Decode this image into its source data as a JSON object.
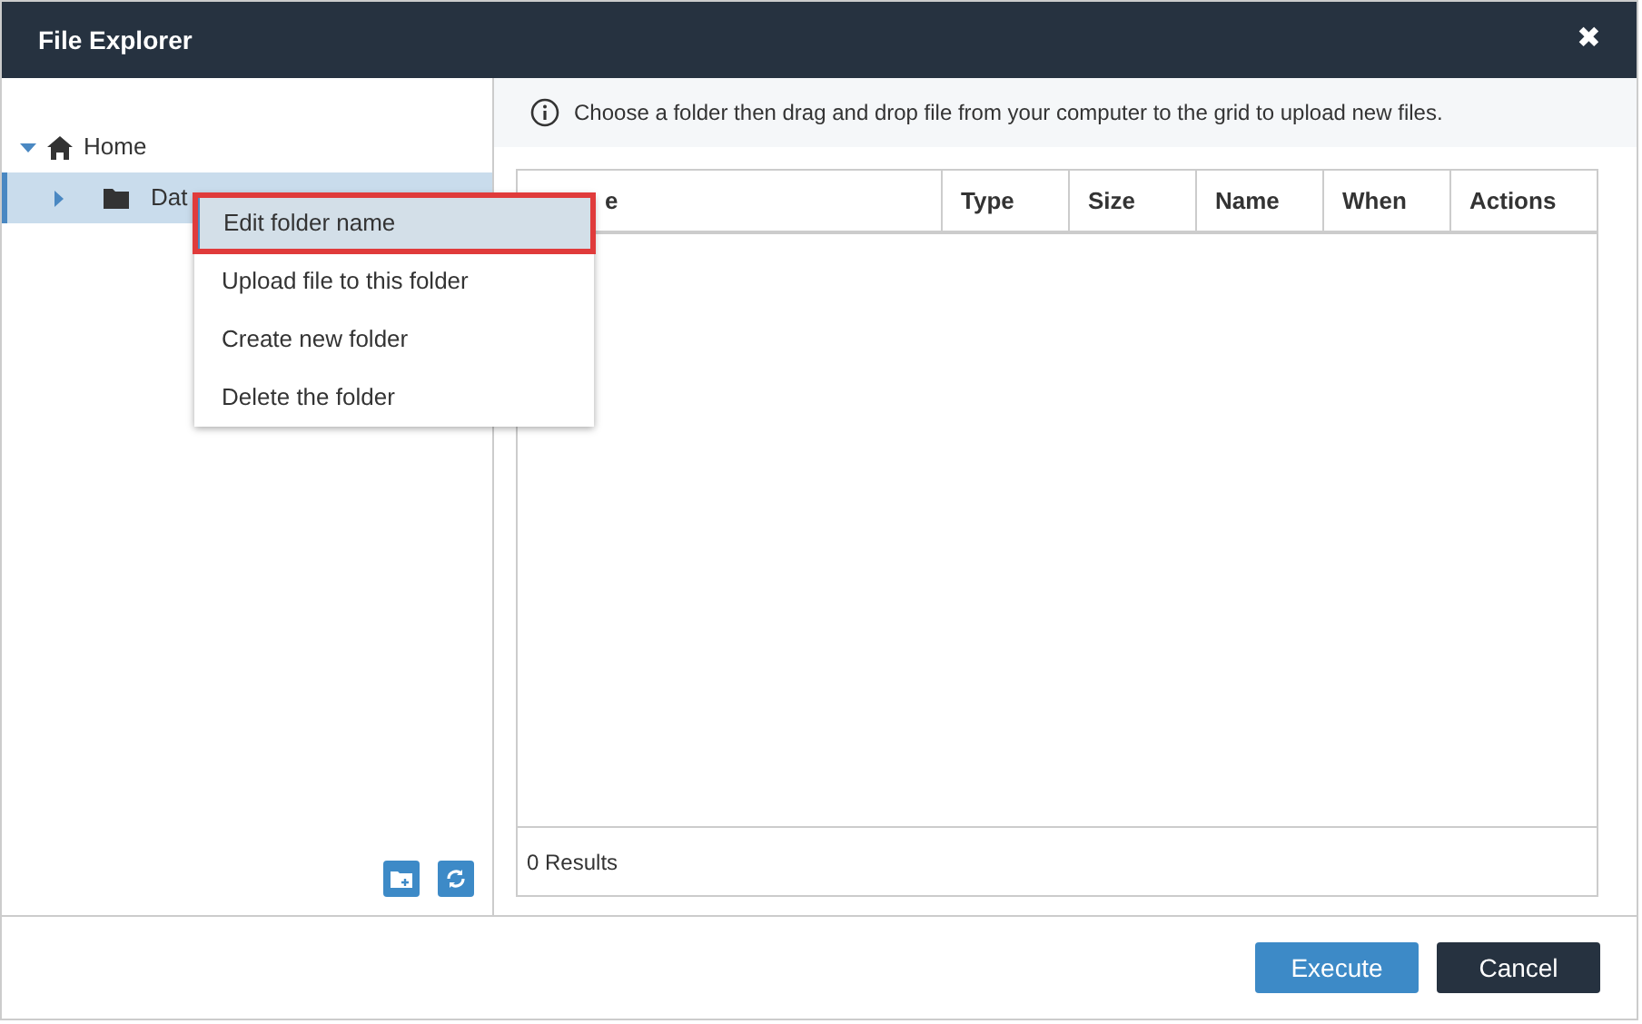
{
  "window": {
    "title": "File Explorer",
    "close": "✖"
  },
  "tree": {
    "label": "Home",
    "expanded": true,
    "children": [
      {
        "label": "Dat",
        "expanded": false,
        "selected": true
      }
    ]
  },
  "context_menu": [
    {
      "label": "Edit folder name",
      "selected": true
    },
    {
      "label": "Upload file to this folder",
      "selected": false
    },
    {
      "label": "Create new folder",
      "selected": false
    },
    {
      "label": "Delete the folder",
      "selected": false
    }
  ],
  "info": "Choose a folder then drag and drop file from your computer to the grid to upload new files.",
  "table": {
    "columns": [
      "e",
      "Type",
      "Size",
      "Name",
      "When",
      "Actions"
    ],
    "footer": "0 Results"
  },
  "buttons": [
    {
      "label": "Execute",
      "kind": "primary"
    },
    {
      "label": "Cancel",
      "kind": "dark"
    }
  ]
}
